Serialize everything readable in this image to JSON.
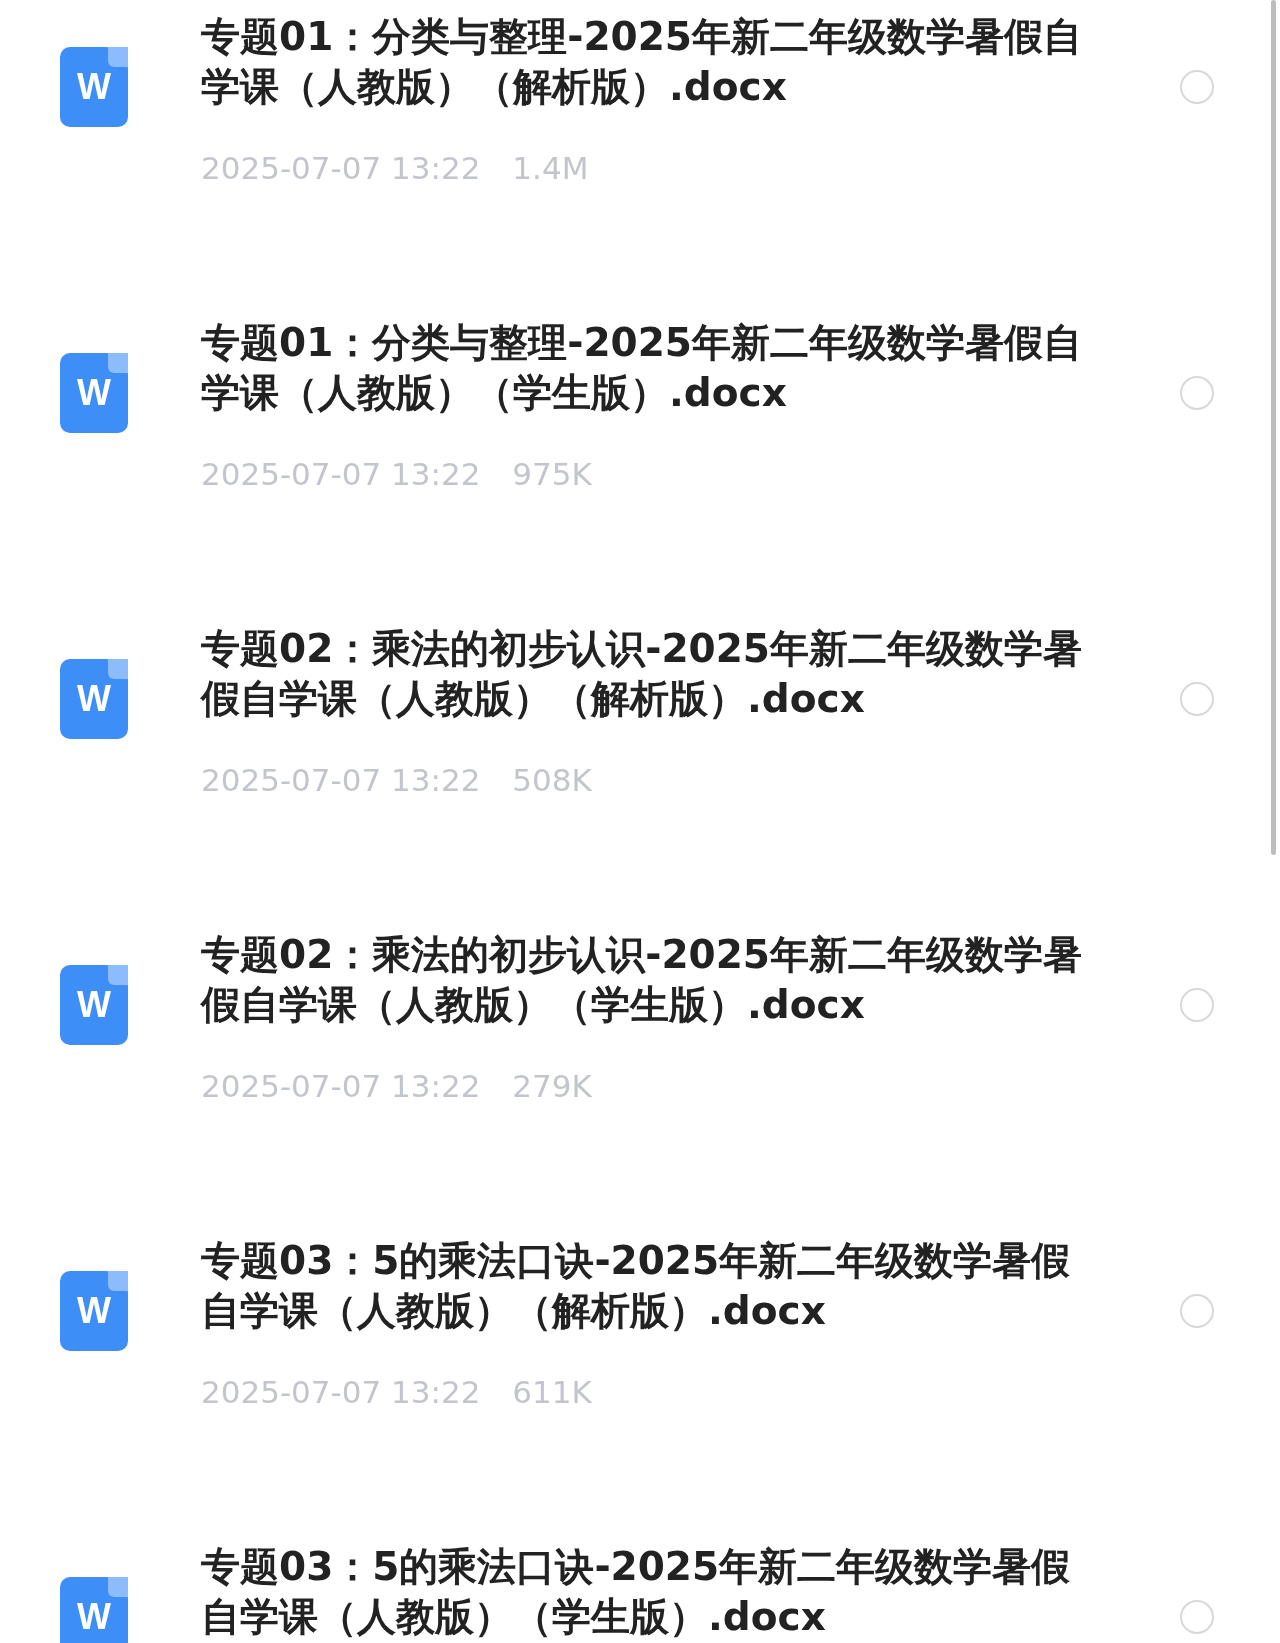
{
  "files": [
    {
      "icon": "W",
      "name": "专题01：分类与整理-2025年新二年级数学暑假自学课（人教版）（解析版）.docx",
      "date": "2025-07-07 13:22",
      "size": "1.4M",
      "selected": false
    },
    {
      "icon": "W",
      "name": "专题01：分类与整理-2025年新二年级数学暑假自学课（人教版）（学生版）.docx",
      "date": "2025-07-07 13:22",
      "size": "975K",
      "selected": false
    },
    {
      "icon": "W",
      "name": "专题02：乘法的初步认识-2025年新二年级数学暑假自学课（人教版）（解析版）.docx",
      "date": "2025-07-07 13:22",
      "size": "508K",
      "selected": false
    },
    {
      "icon": "W",
      "name": "专题02：乘法的初步认识-2025年新二年级数学暑假自学课（人教版）（学生版）.docx",
      "date": "2025-07-07 13:22",
      "size": "279K",
      "selected": false
    },
    {
      "icon": "W",
      "name": "专题03：5的乘法口诀-2025年新二年级数学暑假自学课（人教版）（解析版）.docx",
      "date": "2025-07-07 13:22",
      "size": "611K",
      "selected": false
    },
    {
      "icon": "W",
      "name": "专题03：5的乘法口诀-2025年新二年级数学暑假自学课（人教版）（学生版）.docx",
      "selected": false
    }
  ]
}
